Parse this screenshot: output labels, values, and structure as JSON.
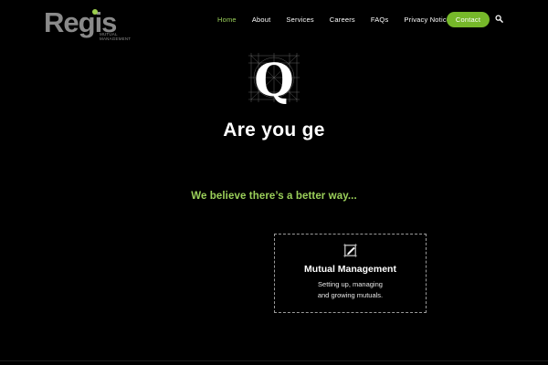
{
  "colors": {
    "background": "#000000",
    "accent": "#76b82a",
    "accent_text": "#9bd05a",
    "logo_gray": "#8a8a8a"
  },
  "logo": {
    "name": "Regis",
    "sub_line1": "MUTUAL",
    "sub_line2": "MANAGEMENT"
  },
  "nav": {
    "items": [
      {
        "label": "Home",
        "active": true
      },
      {
        "label": "About"
      },
      {
        "label": "Services"
      },
      {
        "label": "Careers"
      },
      {
        "label": "FAQs"
      },
      {
        "label": "Privacy Notice"
      }
    ],
    "contact_label": "Contact",
    "search_icon": "search-icon"
  },
  "hero": {
    "icon": "q-grid-icon",
    "icon_letter": "Q",
    "title": "Are you ge",
    "tagline": "We believe there’s a better way..."
  },
  "card": {
    "icon": "pencil-square-icon",
    "title": "Mutual Management",
    "desc_line1": "Setting up, managing",
    "desc_line2": "and growing mutuals."
  }
}
